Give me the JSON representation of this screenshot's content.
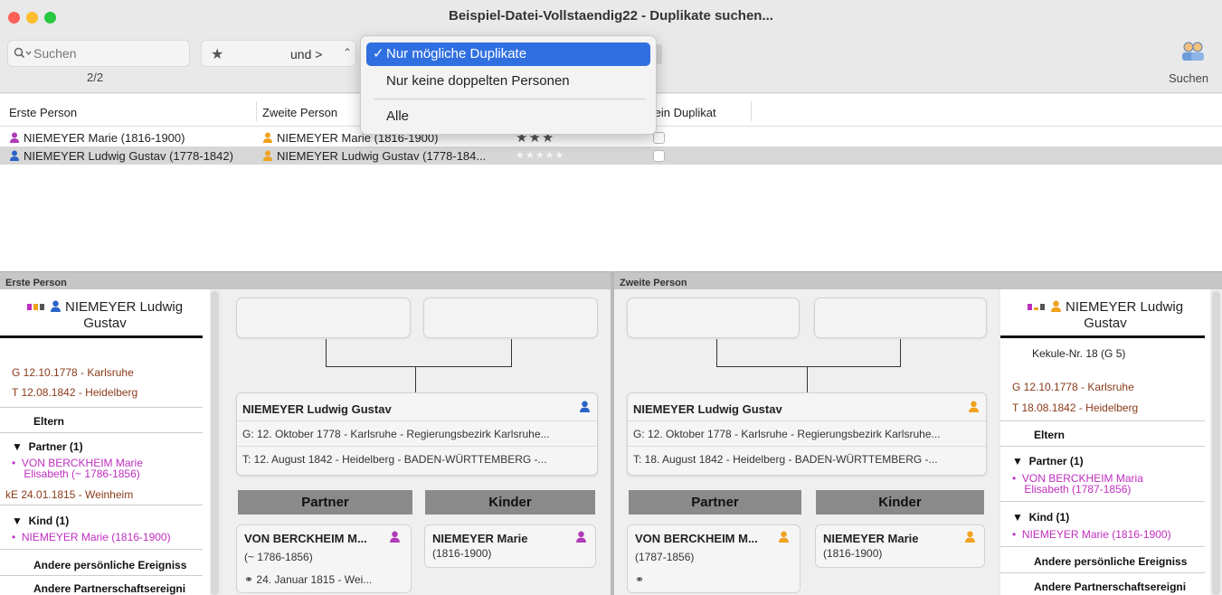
{
  "window": {
    "title": "Beispiel-Datei-Vollstaendig22 - Duplikate suchen...",
    "traffic_colors": {
      "close": "#fe5f57",
      "minimize": "#febc2e",
      "zoom": "#28c840"
    }
  },
  "toolbar": {
    "search_placeholder": "Suchen",
    "search_icon": "magnifier-dropdown-icon",
    "page_count": "2/2",
    "star_filter": "★",
    "combinator": "und >",
    "search_button_label": "Suchen"
  },
  "filter_menu": {
    "options": [
      {
        "label": "Nur mögliche Duplikate",
        "checked": true,
        "check": "✓"
      },
      {
        "label": "Nur keine doppelten Personen",
        "checked": false
      },
      {
        "label": "Alle",
        "checked": false
      }
    ]
  },
  "table": {
    "headers": [
      "Erste Person",
      "Zweite Person",
      "Kein Duplikat"
    ],
    "rows": [
      {
        "first": "NIEMEYER Marie (1816-1900)",
        "second": "NIEMEYER Marie (1816-1900)",
        "stars": "★★★",
        "selected": false
      },
      {
        "first": "NIEMEYER Ludwig Gustav (1778-1842)",
        "second": "NIEMEYER Ludwig Gustav (1778-184...",
        "stars": "★★★★★",
        "selected": true
      }
    ]
  },
  "colors": {
    "female": "#b03ab8",
    "male": "#2a63c7",
    "unknown": "#f0a21e",
    "selected_menu": "#2f6fe0"
  },
  "left": {
    "panel_title": "Erste Person",
    "sidebar": {
      "name_line1": "NIEMEYER Ludwig",
      "name_line2": "Gustav",
      "birth": "G  12.10.1778 - Karlsruhe",
      "death": "T  12.08.1842 - Heidelberg",
      "eltern": "Eltern",
      "partner_title": "Partner (1)",
      "partner_line1": "VON BERCKHEIM Marie",
      "partner_line2": "Elisabeth (~ 1786-1856)",
      "marriage": "kE  24.01.1815 - Weinheim",
      "kind_title": "Kind (1)",
      "kind_name": "NIEMEYER Marie (1816-1900)",
      "other_events": "Andere persönliche Ereigniss",
      "other_partner_events": "Andere Partnerschaftsereigni"
    },
    "card": {
      "name": "NIEMEYER Ludwig Gustav",
      "birth": "G: 12. Oktober 1778 - Karlsruhe - Regierungsbezirk Karlsruhe...",
      "death": "T: 12. August 1842 - Heidelberg - BADEN-WÜRTTEMBERG -..."
    },
    "partner_header": "Partner",
    "kinder_header": "Kinder",
    "partner_card": {
      "name": "VON BERCKHEIM M...",
      "dates": "(~ 1786-1856)",
      "marriage": "24. Januar 1815 - Wei..."
    },
    "kind_card": {
      "name": "NIEMEYER Marie",
      "dates": "(1816-1900)"
    }
  },
  "right": {
    "panel_title": "Zweite Person",
    "sidebar": {
      "name_line1": "NIEMEYER Ludwig",
      "name_line2": "Gustav",
      "kekule": "Kekule-Nr. 18 (G 5)",
      "birth": "G  12.10.1778 - Karlsruhe",
      "death": "T  18.08.1842 - Heidelberg",
      "eltern": "Eltern",
      "partner_title": "Partner (1)",
      "partner_line1": "VON BERCKHEIM Maria",
      "partner_line2": "Elisabeth (1787-1856)",
      "kind_title": "Kind (1)",
      "kind_name": "NIEMEYER Marie (1816-1900)",
      "other_events": "Andere persönliche Ereigniss",
      "other_partner_events": "Andere Partnerschaftsereigni"
    },
    "card": {
      "name": "NIEMEYER Ludwig Gustav",
      "birth": "G: 12. Oktober 1778 - Karlsruhe - Regierungsbezirk Karlsruhe...",
      "death": "T: 18. August 1842 - Heidelberg - BADEN-WÜRTTEMBERG -..."
    },
    "partner_header": "Partner",
    "kinder_header": "Kinder",
    "partner_card": {
      "name": "VON BERCKHEIM M...",
      "dates": "(1787-1856)"
    },
    "kind_card": {
      "name": "NIEMEYER Marie",
      "dates": "(1816-1900)"
    }
  }
}
